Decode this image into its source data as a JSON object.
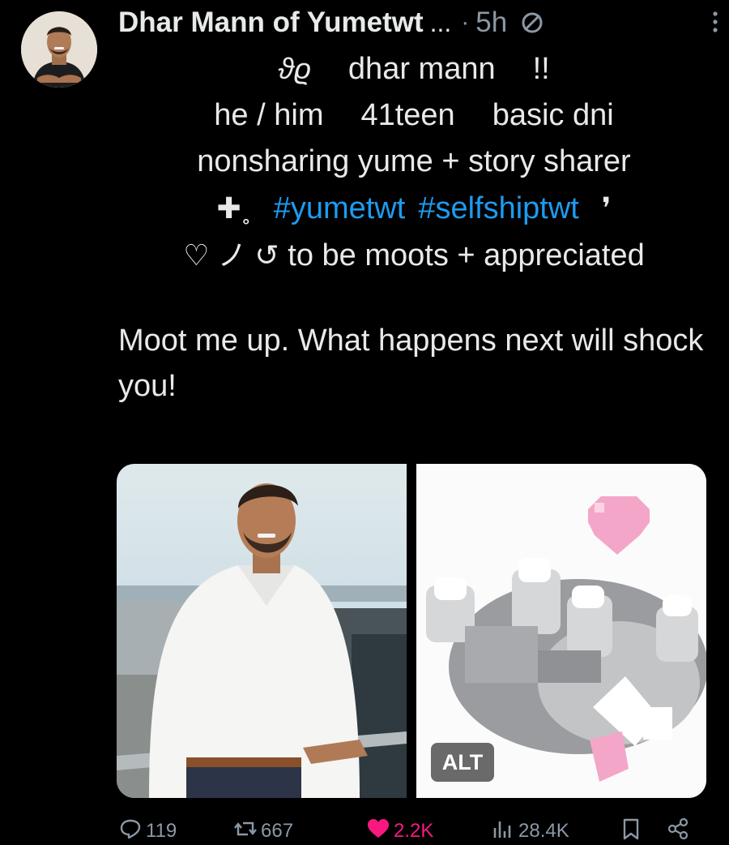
{
  "post": {
    "display_name": "Dhar Mann of Yumetwt",
    "name_truncation": "...",
    "separator": "·",
    "time": "5h",
    "bio_lines": {
      "line1": {
        "symbol": "ϑϱ",
        "name": "dhar mann",
        "mark": "!!"
      },
      "line2": {
        "pronouns": "he / him",
        "age": "41teen",
        "dni": "basic dni"
      },
      "line3": {
        "text": "nonsharing yume + story sharer"
      },
      "line4": {
        "prefix": "✚˳",
        "tag1": "#yumetwt",
        "tag2": "#selfshiptwt",
        "suffix": "❜"
      },
      "line5": {
        "prefix": "♡ ノ ↺",
        "text": "to be moots + appreciated"
      }
    },
    "text": "Moot me up. What happens next will shock you!",
    "media_alt_badge": "ALT"
  },
  "actions": {
    "replies": "119",
    "reposts": "667",
    "likes": "2.2K",
    "views": "28.4K"
  },
  "colors": {
    "background": "#000000",
    "text": "#e7e9ea",
    "muted": "#8b98a5",
    "link": "#1d9bf0",
    "like": "#f91880"
  },
  "icons": [
    "avatar",
    "restrict-reply-icon",
    "more-icon",
    "reply-icon",
    "repost-icon",
    "heart-icon",
    "views-icon",
    "bookmark-icon",
    "share-icon"
  ]
}
